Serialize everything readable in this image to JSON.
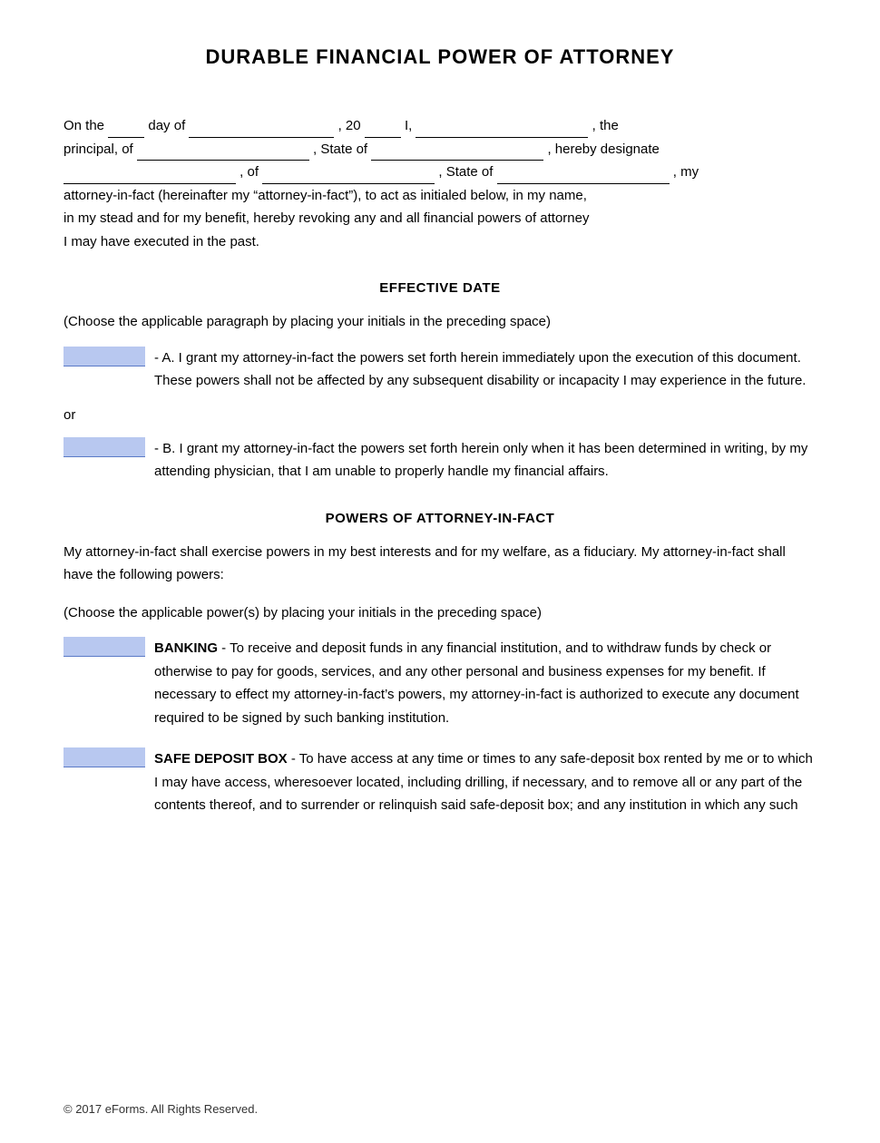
{
  "title": "DURABLE FINANCIAL POWER OF ATTORNEY",
  "intro": {
    "line1_prefix": "On the",
    "day_field": "",
    "line1_middle": "day of",
    "date_field": "",
    "year_prefix": ", 20",
    "year_field": "",
    "name_prefix": "I,",
    "name_field": "",
    "line1_suffix": ", the",
    "line2_prefix": "principal, of",
    "address_field": "",
    "state_prefix": ", State of",
    "state_field": "",
    "line2_suffix": ", hereby designate",
    "line3_name_field": "",
    "line3_of": ", of",
    "line3_address_field": "",
    "line3_state_prefix": ", State of",
    "line3_state_field": "",
    "line3_suffix": ", my",
    "line4": "attorney-in-fact (hereinafter my “attorney-in-fact”), to act as initialed below, in my name,",
    "line5": "in my stead and for my benefit, hereby revoking any and all financial powers of attorney",
    "line6": "I may have executed in the past."
  },
  "effective_date": {
    "title": "EFFECTIVE DATE",
    "note": "(Choose the applicable paragraph by placing your initials in the preceding space)",
    "option_a_initials": "",
    "option_a_text": "- A. I grant my attorney-in-fact the powers set forth herein immediately upon the execution of this document. These powers shall not be affected by any subsequent disability or incapacity I may experience in the future.",
    "or_text": "or",
    "option_b_initials": "",
    "option_b_text": "- B. I grant my attorney-in-fact the powers set forth herein only when it has been determined in writing, by my attending physician, that I am unable to properly handle my financial affairs."
  },
  "powers_section": {
    "title": "POWERS OF ATTORNEY-IN-FACT",
    "intro1": "My attorney-in-fact shall exercise powers in my best interests and for my welfare, as a fiduciary. My attorney-in-fact shall have the following powers:",
    "note": "(Choose the applicable power(s) by placing your initials in the preceding space)",
    "banking_initials": "",
    "banking_label": "BANKING",
    "banking_text": "- To receive and deposit funds in any financial institution, and to withdraw funds by check or otherwise to pay for goods, services, and any other personal and business expenses for my benefit.  If necessary to effect my attorney-in-fact’s powers, my attorney-in-fact is authorized to execute any document required to be signed by such banking institution.",
    "safe_deposit_initials": "",
    "safe_deposit_label": "SAFE DEPOSIT BOX",
    "safe_deposit_text": "- To have access at any time or times to any safe-deposit box rented by me or to which I may have access, wheresoever located, including drilling, if necessary, and to remove all or any part of the contents thereof, and to surrender or relinquish said safe-deposit box; and any institution in which any such"
  },
  "footer": {
    "text": "© 2017 eForms. All Rights Reserved."
  }
}
